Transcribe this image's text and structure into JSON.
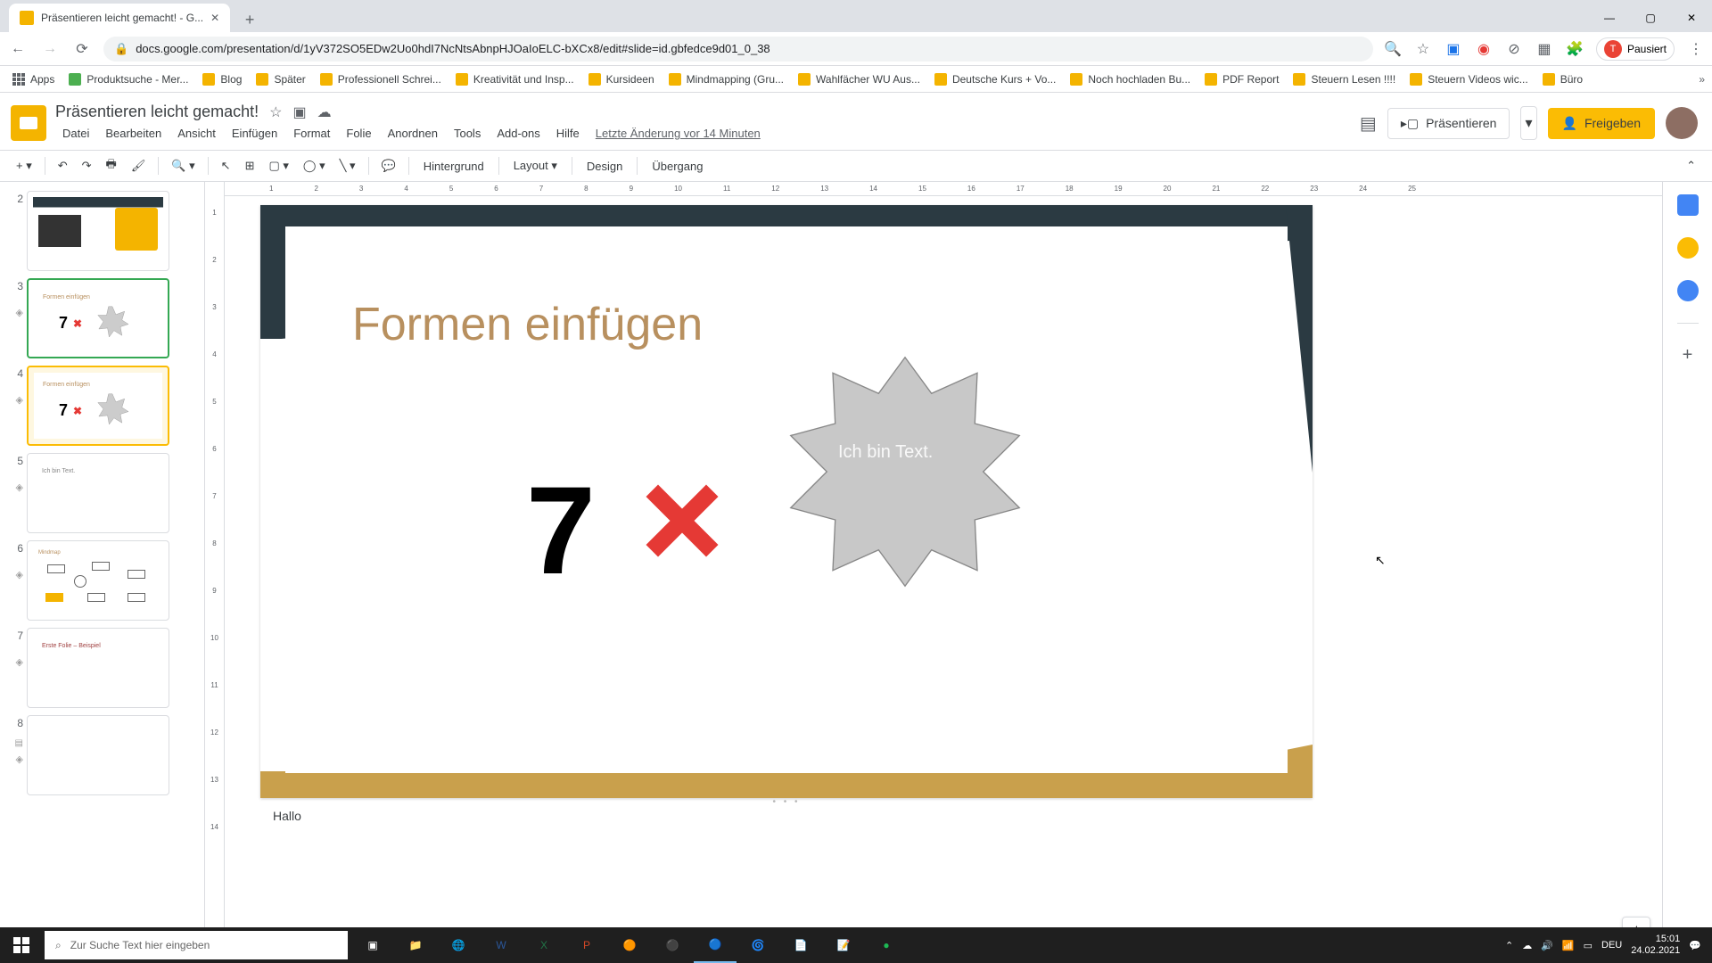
{
  "browser": {
    "tab_title": "Präsentieren leicht gemacht! - G...",
    "url": "docs.google.com/presentation/d/1yV372SO5EDw2Uo0hdI7NcNtsAbnpHJOaIoELC-bXCx8/edit#slide=id.gbfedce9d01_0_38",
    "profile_status": "Pausiert",
    "bookmarks": {
      "apps": "Apps",
      "items": [
        "Produktsuche - Mer...",
        "Blog",
        "Später",
        "Professionell Schrei...",
        "Kreativität und Insp...",
        "Kursideen",
        "Mindmapping (Gru...",
        "Wahlfächer WU Aus...",
        "Deutsche Kurs + Vo...",
        "Noch hochladen Bu...",
        "PDF Report",
        "Steuern Lesen !!!!",
        "Steuern Videos wic...",
        "Büro"
      ]
    }
  },
  "app": {
    "doc_title": "Präsentieren leicht gemacht!",
    "menus": [
      "Datei",
      "Bearbeiten",
      "Ansicht",
      "Einfügen",
      "Format",
      "Folie",
      "Anordnen",
      "Tools",
      "Add-ons",
      "Hilfe"
    ],
    "last_edit": "Letzte Änderung vor 14 Minuten",
    "present": "Präsentieren",
    "share": "Freigeben"
  },
  "toolbar": {
    "background": "Hintergrund",
    "layout": "Layout",
    "design": "Design",
    "transition": "Übergang"
  },
  "ruler_h": [
    "1",
    "2",
    "3",
    "4",
    "5",
    "6",
    "7",
    "8",
    "9",
    "10",
    "11",
    "12",
    "13",
    "14",
    "15",
    "16",
    "17",
    "18",
    "19",
    "20",
    "21",
    "22",
    "23",
    "24",
    "25"
  ],
  "ruler_v": [
    "1",
    "2",
    "3",
    "4",
    "5",
    "6",
    "7",
    "8",
    "9",
    "10",
    "11",
    "12",
    "13",
    "14"
  ],
  "filmstrip": {
    "slides": [
      {
        "num": "2",
        "type": "image"
      },
      {
        "num": "3",
        "type": "formen",
        "green": true
      },
      {
        "num": "4",
        "type": "formen",
        "selected": true
      },
      {
        "num": "5",
        "type": "text"
      },
      {
        "num": "6",
        "type": "mindmap"
      },
      {
        "num": "7",
        "type": "first"
      },
      {
        "num": "8",
        "type": "blank"
      }
    ],
    "thumb_title_formen": "Formen einfügen",
    "thumb_title_text": "Ich bin Text.",
    "thumb_title_mindmap": "Mindmap",
    "thumb_title_first": "Erste Folie – Beispiel",
    "thumb_seven": "7",
    "thumb_x": "✖"
  },
  "slide": {
    "title": "Formen einfügen",
    "big_text": "7",
    "shape_text": "Ich bin Text."
  },
  "notes": "Hallo",
  "taskbar": {
    "search_placeholder": "Zur Suche Text hier eingeben",
    "lang": "DEU",
    "time": "15:01",
    "date": "24.02.2021"
  }
}
